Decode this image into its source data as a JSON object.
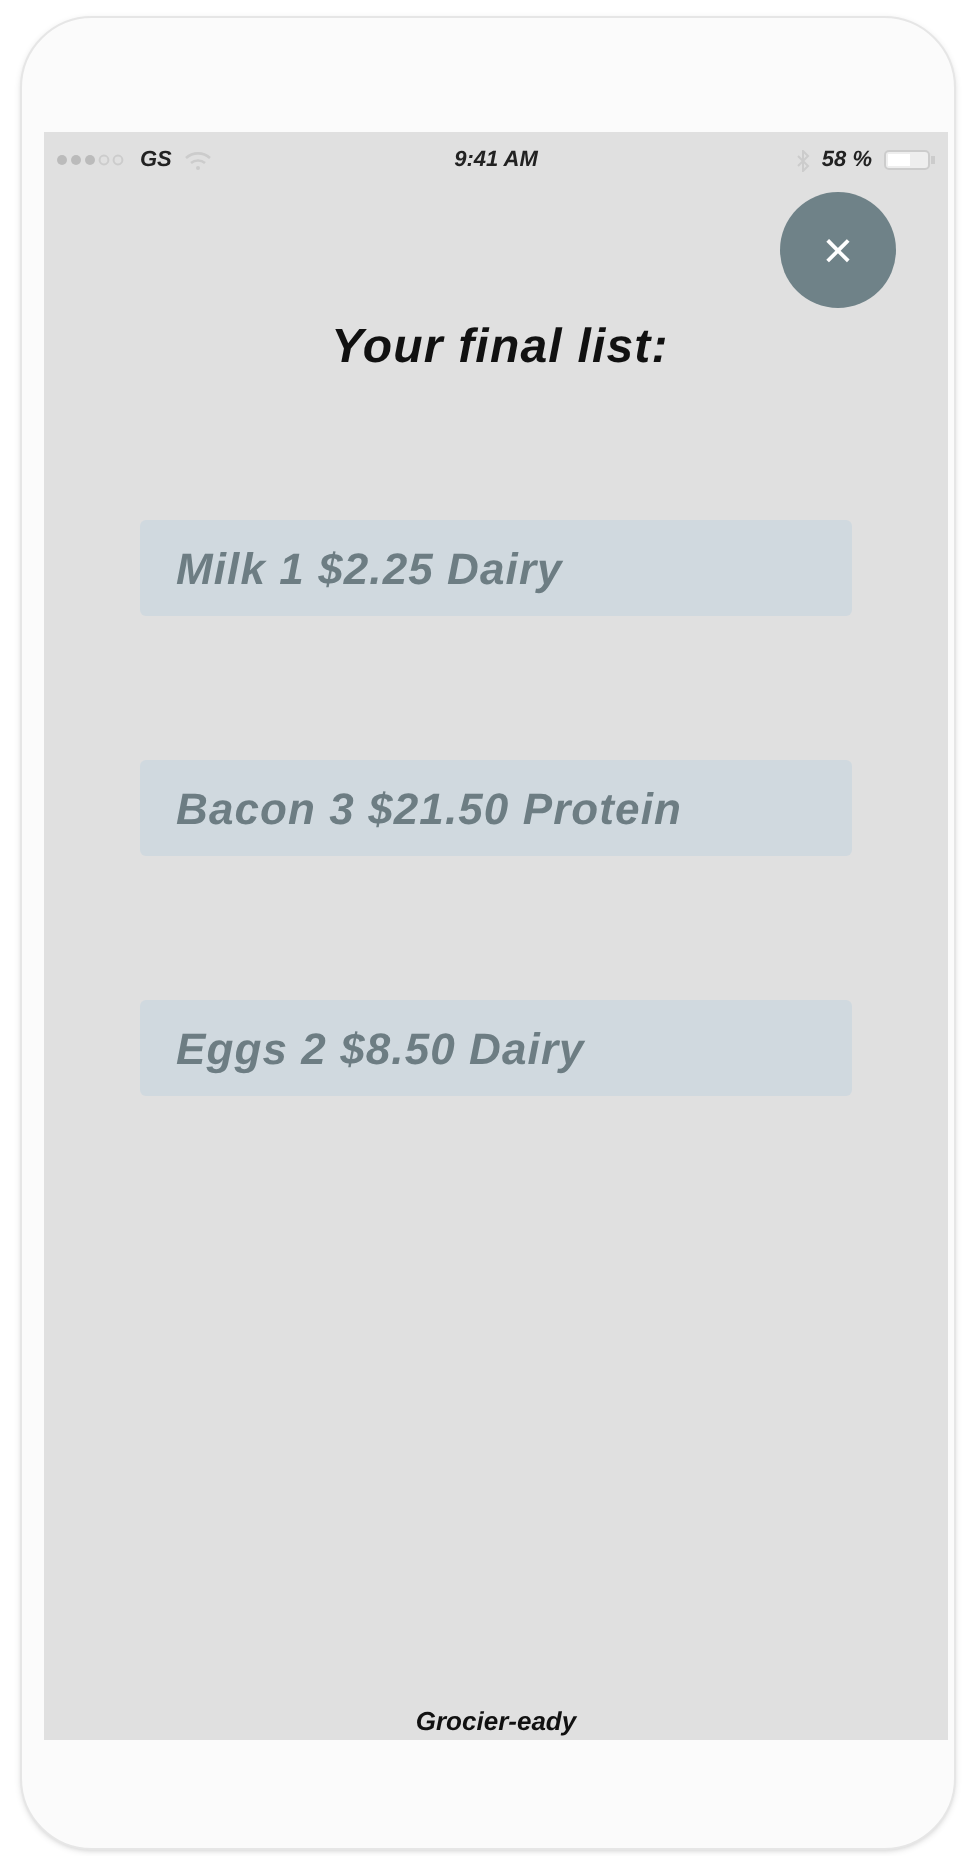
{
  "status_bar": {
    "carrier": "GS",
    "time": "9:41 AM",
    "battery": "58 %"
  },
  "close_button": {
    "label": "×"
  },
  "title": "Your final list:",
  "items": [
    {
      "text": "Milk 1 $2.25 Dairy"
    },
    {
      "text": "Bacon 3 $21.50 Protein"
    },
    {
      "text": "Eggs 2 $8.50 Dairy"
    }
  ],
  "footer": "Grocier-eady"
}
